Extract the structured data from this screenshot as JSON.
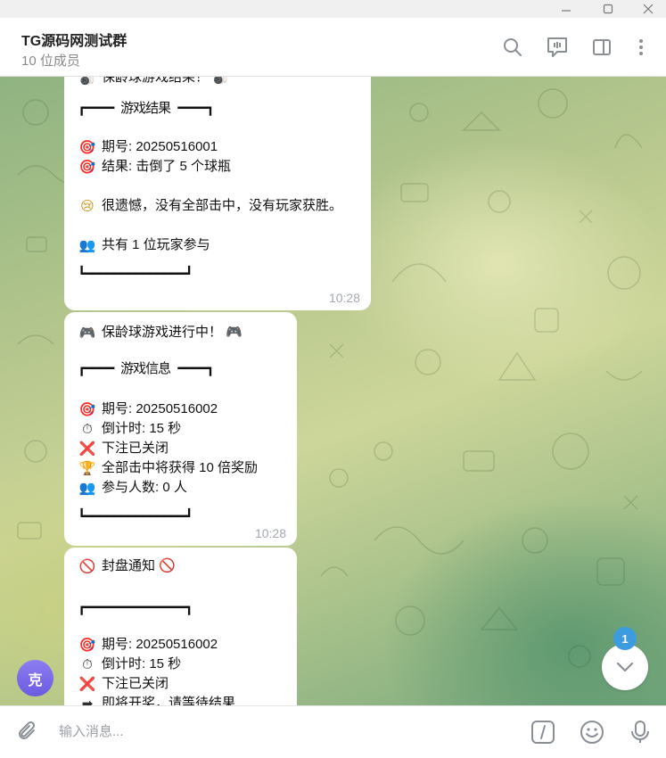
{
  "window": {
    "minimize_glyph": "—",
    "maximize_glyph": "☐",
    "close_glyph": "✕"
  },
  "header": {
    "title": "TG源码网测试群",
    "subtitle": "10 位成员",
    "icons": [
      "search-icon",
      "live-stream-icon",
      "sidebar-toggle-icon",
      "more-menu-icon"
    ]
  },
  "messages": [
    {
      "lines": [
        {
          "icon": "bowling-icon",
          "emoji": "🎳",
          "text": "保龄球游戏结果！ 🎳"
        },
        {
          "icon": null,
          "emoji": "",
          "text": "┏━━━━ 游戏结果 ━━━━┓"
        },
        {
          "icon": "target-icon",
          "emoji": "🎯",
          "text": "期号: 20250516001"
        },
        {
          "icon": "target-icon",
          "emoji": "🎯",
          "text": "结果: 击倒了 5 个球瓶"
        },
        {
          "icon": "sad-face-icon",
          "emoji": "😢",
          "text": "很遗憾，没有全部击中，没有玩家获胜。"
        },
        {
          "icon": "players-icon",
          "emoji": "👥",
          "text": "共有 1 位玩家参与"
        },
        {
          "icon": null,
          "emoji": "",
          "text": "┗━━━━━━━━━━━━━━┛"
        }
      ],
      "time": "10:28"
    },
    {
      "lines": [
        {
          "icon": "gamepad-icon",
          "emoji": "🎮",
          "text": "保龄球游戏进行中！ 🎮"
        },
        {
          "icon": null,
          "emoji": "",
          "text": "┏━━━━ 游戏信息 ━━━━┓"
        },
        {
          "icon": "target-icon",
          "emoji": "🎯",
          "text": "期号: 20250516002"
        },
        {
          "icon": "stopwatch-icon",
          "emoji": "⏱",
          "text": "倒计时: 15 秒"
        },
        {
          "icon": "cross-mark-icon",
          "emoji": "❌",
          "text": "下注已关闭"
        },
        {
          "icon": "trophy-icon",
          "emoji": "🏆",
          "text": "全部击中将获得 10 倍奖励"
        },
        {
          "icon": "players-icon",
          "emoji": "👥",
          "text": "参与人数: 0 人"
        },
        {
          "icon": null,
          "emoji": "",
          "text": "┗━━━━━━━━━━━━━━┛"
        }
      ],
      "time": "10:28"
    },
    {
      "lines": [
        {
          "icon": "prohibited-icon",
          "emoji": "🚫",
          "text": "封盘通知 🚫"
        },
        {
          "icon": null,
          "emoji": "",
          "text": "┏━━━━━━━━━━━━━━┓"
        },
        {
          "icon": "target-icon",
          "emoji": "🎯",
          "text": "期号: 20250516002"
        },
        {
          "icon": "stopwatch-icon",
          "emoji": "⏱",
          "text": "倒计时: 15 秒"
        },
        {
          "icon": "cross-mark-icon",
          "emoji": "❌",
          "text": "下注已关闭"
        },
        {
          "icon": "right-arrow-icon",
          "emoji": "➡",
          "text": "即将开奖，请等待结果"
        }
      ],
      "time": ""
    }
  ],
  "sender_avatar": {
    "letter": "克",
    "color": "#7b6ae6"
  },
  "scroll_down": {
    "unread_count": "1"
  },
  "composer": {
    "placeholder": "输入消息...",
    "icons": [
      "attach-icon",
      "slash-command-icon",
      "emoji-icon",
      "microphone-icon"
    ]
  },
  "colors": {
    "accent": "#3d9be0",
    "bubble": "#ffffff",
    "time": "#a3a9b0"
  }
}
